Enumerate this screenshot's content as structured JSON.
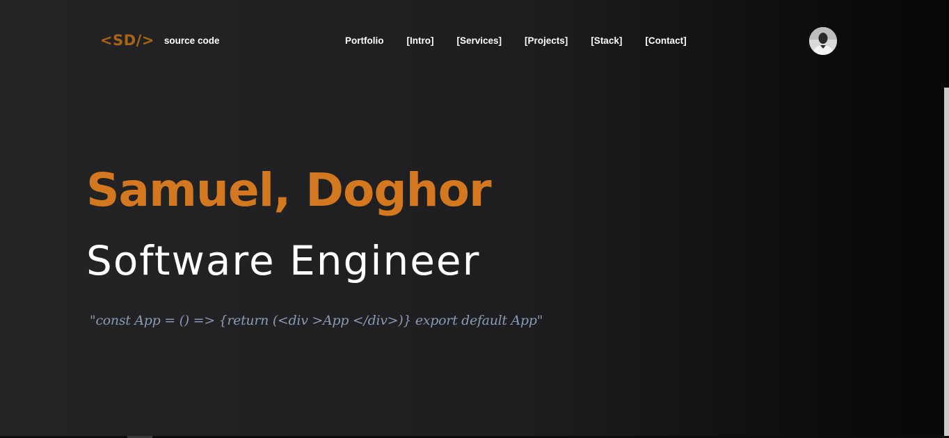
{
  "header": {
    "logo_mark": "<SD/>",
    "logo_text": "source code",
    "nav": [
      {
        "label": "Portfolio"
      },
      {
        "label": "[Intro]"
      },
      {
        "label": "[Services]"
      },
      {
        "label": "[Projects]"
      },
      {
        "label": "[Stack]"
      },
      {
        "label": "[Contact]"
      }
    ],
    "avatar_icon": "profile-photo"
  },
  "hero": {
    "name": "Samuel, Doghor",
    "role": "Software Engineer",
    "quote": "\"const App = () => {return (<div >App </div>)} export default App\""
  },
  "colors": {
    "accent": "#d4781f",
    "logo": "#a86518",
    "quote": "#8a9bb6",
    "background": "#1e1e20"
  }
}
